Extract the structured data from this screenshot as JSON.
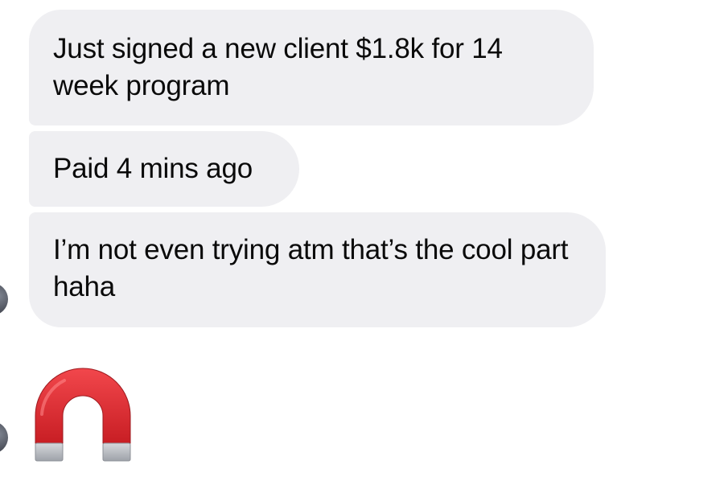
{
  "messages": [
    {
      "text": "Just signed a new client $1.8k for 14 week program"
    },
    {
      "text": "Paid 4 mins ago"
    },
    {
      "text": "I’m not even trying atm that’s the cool part haha"
    }
  ],
  "reaction": {
    "icon": "magnet-icon",
    "colors": {
      "body": "#e0282e",
      "tips": "#b9bcc2"
    }
  },
  "colors": {
    "bubble_background": "#efeff2",
    "text": "#0a0a0a",
    "background": "#ffffff"
  }
}
